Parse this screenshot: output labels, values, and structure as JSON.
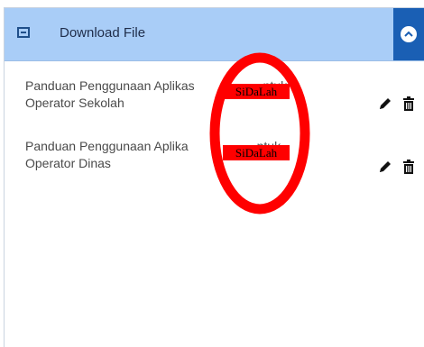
{
  "panel": {
    "title": "Download File",
    "header_icon": "list-collapse-icon",
    "collapse_icon": "chevron-up-icon"
  },
  "files": [
    {
      "line1_start": "Panduan Penggunaan Aplikas",
      "line1_end": "ntuk",
      "line2": "Operator Sekolah",
      "redaction_label": "SiDaLah"
    },
    {
      "line1_start": "Panduan Penggunaan Aplika",
      "line1_end": "ntuk",
      "line2": "Operator Dinas",
      "redaction_label": "SiDaLah"
    }
  ],
  "icons": {
    "edit": "pencil-icon",
    "delete": "trash-icon"
  },
  "colors": {
    "header_bg": "#a9cdf7",
    "collapse_bg": "#1a5fb4",
    "annotation_red": "#ff0000"
  }
}
